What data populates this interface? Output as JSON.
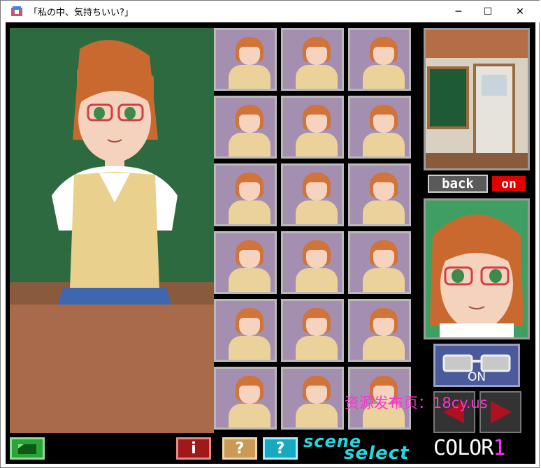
{
  "window": {
    "title": "「私の中、気持ちいい?」",
    "minimize_glyph": "─",
    "maximize_glyph": "☐",
    "close_glyph": "✕"
  },
  "gallery": {
    "rows": 6,
    "cols": 3
  },
  "controls": {
    "back_label": "back",
    "on_label": "on",
    "glasses_label": "ON",
    "info_label": "i",
    "help1_label": "?",
    "help2_label": "?",
    "scene_select_word1": "scene",
    "scene_select_word2": "select",
    "color_label": "COLOR",
    "color_number": "1"
  },
  "watermark": "资源发布页：18cy.us",
  "colors": {
    "back_bg": "#5a5a5a",
    "on_bg": "#e00000",
    "scene_select": "#22d7e0",
    "color_number": "#ff33ff",
    "watermark": "#ff33cc"
  }
}
